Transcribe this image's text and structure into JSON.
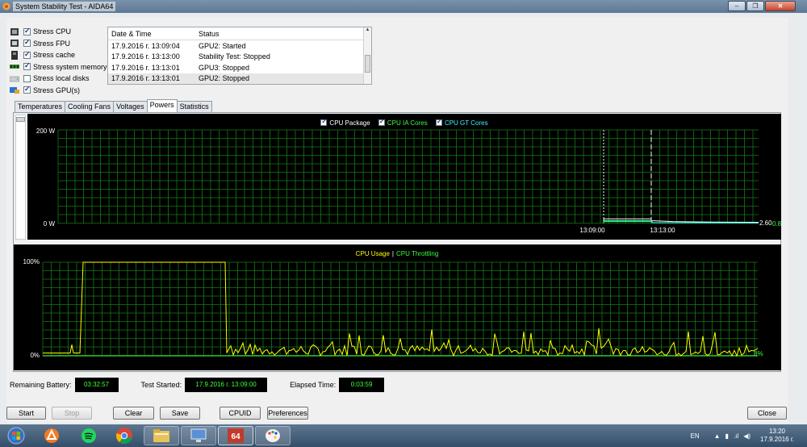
{
  "window": {
    "title": "System Stability Test - AIDA64",
    "buttons": [
      "–",
      "❐",
      "✕"
    ]
  },
  "stress": [
    {
      "label": "Stress CPU",
      "checked": true
    },
    {
      "label": "Stress FPU",
      "checked": true
    },
    {
      "label": "Stress cache",
      "checked": true
    },
    {
      "label": "Stress system memory",
      "checked": true
    },
    {
      "label": "Stress local disks",
      "checked": false
    },
    {
      "label": "Stress GPU(s)",
      "checked": true
    }
  ],
  "log": {
    "columns": [
      "Date & Time",
      "Status"
    ],
    "rows": [
      [
        "17.9.2016 г. 13:09:04",
        "GPU2: Started"
      ],
      [
        "17.9.2016 г. 13:13:00",
        "Stability Test: Stopped"
      ],
      [
        "17.9.2016 г. 13:13:01",
        "GPU3: Stopped"
      ],
      [
        "17.9.2016 г. 13:13:01",
        "GPU2: Stopped"
      ]
    ]
  },
  "tabs": [
    "Temperatures",
    "Cooling Fans",
    "Voltages",
    "Powers",
    "Statistics"
  ],
  "active_tab": "Powers",
  "power_chart": {
    "legend": [
      {
        "name": "CPU Package",
        "color": "#ffffff"
      },
      {
        "name": "CPU IA Cores",
        "color": "#3dff3d"
      },
      {
        "name": "CPU GT Cores",
        "color": "#3df5ff"
      }
    ],
    "ymax_label": "200 W",
    "ymin_label": "0 W",
    "time_labels": [
      "13:09:00",
      "13:13:00"
    ],
    "value_labels": [
      "2.60",
      "0.84"
    ]
  },
  "usage_chart": {
    "legend_usage": "CPU Usage",
    "legend_sep": "|",
    "legend_throttling": "CPU Throttling",
    "ymax_label": "100%",
    "ymin_label": "0%",
    "value_label": "8%",
    "usage_color": "#ffff00",
    "throttle_color": "#3dff3d"
  },
  "status": {
    "battery_label": "Remaining Battery:",
    "battery_value": "03:32:57",
    "started_label": "Test Started:",
    "started_value": "17.9.2016 г. 13:09:00",
    "elapsed_label": "Elapsed Time:",
    "elapsed_value": "0:03:59"
  },
  "buttons": {
    "start": "Start",
    "stop": "Stop",
    "clear": "Clear",
    "save": "Save",
    "cpuid": "CPUID",
    "preferences": "Preferences",
    "close": "Close"
  },
  "taskbar": {
    "apps": [
      "start-orb",
      "avast",
      "spotify",
      "chrome",
      "file-explorer",
      "remote-desktop",
      "aida64",
      "paint"
    ],
    "lang": "EN",
    "time": "13:20",
    "date": "17.9.2016 г."
  },
  "chart_data": [
    {
      "type": "line",
      "series": [
        {
          "name": "CPU Package",
          "x": [
            "13:09:00",
            "13:13:00",
            "end"
          ],
          "values": [
            10,
            6,
            2.6
          ]
        },
        {
          "name": "CPU IA Cores",
          "x": [
            "13:09:00",
            "13:13:00",
            "end"
          ],
          "values": [
            4,
            2,
            0.84
          ]
        }
      ],
      "ylim": [
        0,
        200
      ]
    },
    {
      "type": "line",
      "series": [
        {
          "name": "CPU Usage",
          "values": [
            3,
            100,
            100,
            100,
            3,
            12,
            20,
            15,
            25,
            10,
            15,
            18,
            20,
            8,
            10,
            15,
            5,
            12,
            18,
            8
          ]
        },
        {
          "name": "CPU Throttling",
          "values": [
            0,
            0,
            0,
            0,
            0,
            0,
            0,
            0,
            0,
            0,
            0,
            0,
            0,
            0,
            0,
            0,
            0,
            0,
            0,
            0
          ]
        }
      ],
      "ylim": [
        0,
        100
      ]
    }
  ]
}
